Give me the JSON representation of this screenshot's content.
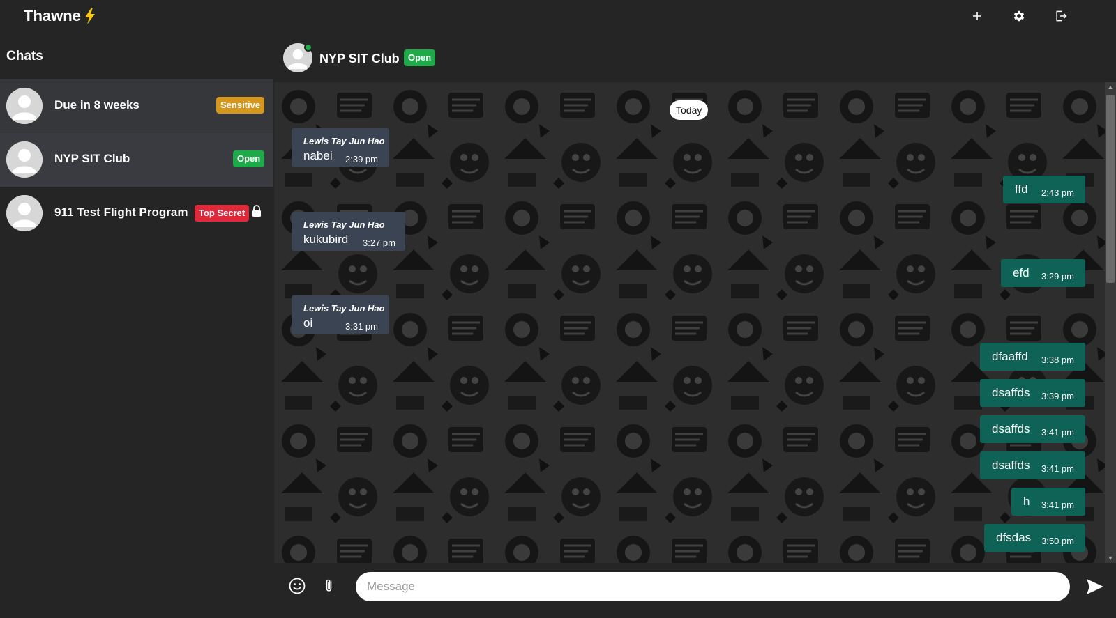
{
  "app": {
    "name": "Thawne"
  },
  "topbar": {
    "icons": [
      "plus-icon",
      "gear-icon",
      "logout-icon"
    ]
  },
  "sidebar": {
    "title": "Chats",
    "chats": [
      {
        "name": "Due in 8 weeks",
        "badge": "Sensitive",
        "badge_color": "#d4961c",
        "active": false,
        "locked": false
      },
      {
        "name": "NYP SIT Club",
        "badge": "Open",
        "badge_color": "#1faa49",
        "active": true,
        "locked": false
      },
      {
        "name": "911 Test Flight Program",
        "badge": "Top Secret",
        "badge_color": "#e0293a",
        "active": false,
        "locked": true
      }
    ]
  },
  "chat": {
    "name": "NYP SIT Club",
    "badge": "Open",
    "online": true,
    "date_divider": "Today",
    "messages": [
      {
        "direction": "in",
        "sender": "Lewis Tay Jun Hao",
        "text": "nabei",
        "time": "2:39 pm"
      },
      {
        "direction": "out",
        "text": "ffd",
        "time": "2:43 pm"
      },
      {
        "direction": "in",
        "sender": "Lewis Tay Jun Hao",
        "text": "kukubird",
        "time": "3:27 pm"
      },
      {
        "direction": "out",
        "text": "efd",
        "time": "3:29 pm"
      },
      {
        "direction": "in",
        "sender": "Lewis Tay Jun Hao",
        "text": "oi",
        "time": "3:31 pm"
      },
      {
        "direction": "out",
        "text": "dfaaffd",
        "time": "3:38 pm"
      },
      {
        "direction": "out",
        "text": "dsaffds",
        "time": "3:39 pm"
      },
      {
        "direction": "out",
        "text": "dsaffds",
        "time": "3:41 pm"
      },
      {
        "direction": "out",
        "text": "dsaffds",
        "time": "3:41 pm"
      },
      {
        "direction": "out",
        "text": "h",
        "time": "3:41 pm"
      },
      {
        "direction": "out",
        "text": "dfsdas",
        "time": "3:50 pm"
      }
    ]
  },
  "composer": {
    "placeholder": "Message",
    "value": ""
  },
  "colors": {
    "background": "#252525",
    "incoming_bubble": "#3b4452",
    "outgoing_bubble": "#0e6256",
    "active_chat": "#3a3b40",
    "bolt": "#f5c518"
  }
}
